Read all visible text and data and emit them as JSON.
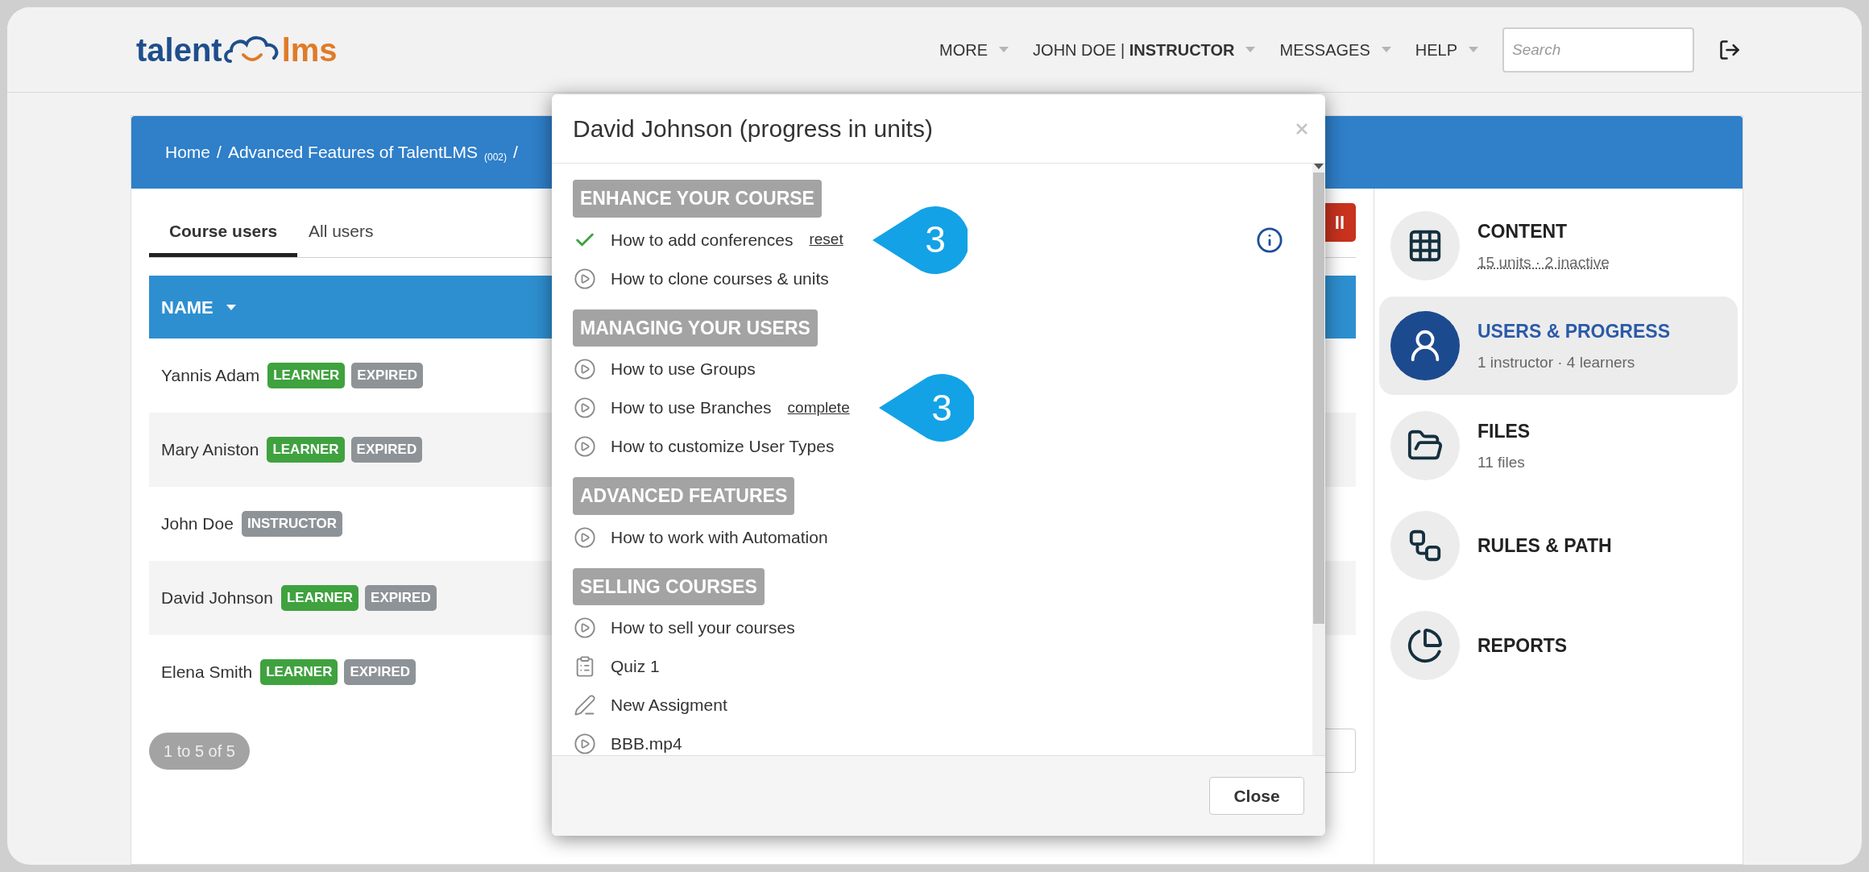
{
  "logo": {
    "first": "talent",
    "second": "lms"
  },
  "nav": [
    {
      "label": "MORE"
    },
    {
      "label": "JOHN DOE | **INSTRUCTOR**"
    },
    {
      "label": "MESSAGES"
    },
    {
      "label": "HELP"
    }
  ],
  "search": {
    "placeholder": "Search"
  },
  "breadcrumb": [
    {
      "kind": "link",
      "text": "Home"
    },
    {
      "kind": "sep",
      "text": "/"
    },
    {
      "kind": "link",
      "text": "Advanced Features of TalentLMS"
    },
    {
      "kind": "code",
      "text": "(002)"
    },
    {
      "kind": "sep",
      "text": "/"
    }
  ],
  "tabs": [
    {
      "label": "Course users",
      "selected": true
    },
    {
      "label": "All users",
      "selected": false
    }
  ],
  "action_button": {
    "label": "ll"
  },
  "table": {
    "columns": [
      {
        "label": "NAME",
        "sorted": true
      }
    ],
    "rows": [
      {
        "name": "Yannis Adam",
        "badges": [
          {
            "label": "LEARNER",
            "kind": "role"
          },
          {
            "label": "EXPIRED",
            "kind": "status"
          }
        ]
      },
      {
        "name": "Mary Aniston",
        "badges": [
          {
            "label": "LEARNER",
            "kind": "role"
          },
          {
            "label": "EXPIRED",
            "kind": "status"
          }
        ]
      },
      {
        "name": "John Doe",
        "badges": [
          {
            "label": "INSTRUCTOR",
            "kind": "status"
          }
        ]
      },
      {
        "name": "David Johnson",
        "badges": [
          {
            "label": "LEARNER",
            "kind": "role"
          },
          {
            "label": "EXPIRED",
            "kind": "status"
          }
        ]
      },
      {
        "name": "Elena Smith",
        "badges": [
          {
            "label": "LEARNER",
            "kind": "role"
          },
          {
            "label": "EXPIRED",
            "kind": "status"
          }
        ]
      }
    ]
  },
  "pagination": "1 to 5 of 5",
  "sidebar": [
    {
      "title": "CONTENT",
      "subtitle": "15 units · 2 inactive",
      "selected": false
    },
    {
      "title": "USERS & PROGRESS",
      "subtitle": "1 instructor · 4 learners",
      "selected": true
    },
    {
      "title": "FILES",
      "subtitle": "11 files",
      "selected": false
    },
    {
      "title": "RULES & PATH",
      "selected": false
    },
    {
      "title": "REPORTS",
      "selected": false
    }
  ],
  "modal": {
    "title": "David Johnson (progress in units)",
    "sections": [
      {
        "title": "ENHANCE YOUR COURSE",
        "units": [
          {
            "name": "How to add conferences",
            "completed": true,
            "action": "reset",
            "callout": "3",
            "info": true
          },
          {
            "name": "How to clone courses & units",
            "kind": "video",
            "completed": false
          }
        ]
      },
      {
        "title": "MANAGING YOUR USERS",
        "units": [
          {
            "name": "How to use Groups",
            "kind": "video",
            "completed": false
          },
          {
            "name": "How to use Branches",
            "kind": "video",
            "completed": false,
            "action": "complete",
            "callout": "3"
          },
          {
            "name": "How to customize User Types",
            "kind": "video",
            "completed": false
          }
        ]
      },
      {
        "title": "ADVANCED FEATURES",
        "units": [
          {
            "name": "How to work with Automation",
            "kind": "video",
            "completed": false
          }
        ]
      },
      {
        "title": "SELLING COURSES",
        "units": [
          {
            "name": "How to sell your courses",
            "kind": "video",
            "completed": false
          },
          {
            "name": "Quiz 1",
            "kind": "quiz",
            "completed": false
          },
          {
            "name": "New Assigment",
            "kind": "assignment",
            "completed": false
          },
          {
            "name": "BBB.mp4",
            "kind": "video",
            "completed": false
          }
        ]
      }
    ],
    "close_button": "Close"
  }
}
